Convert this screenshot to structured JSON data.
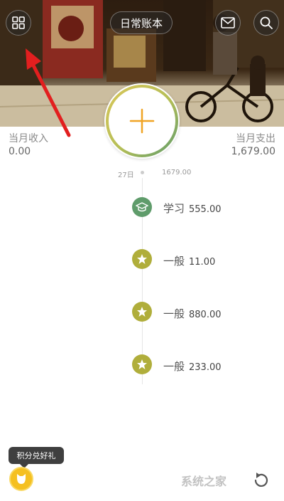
{
  "header": {
    "book_title": "日常账本",
    "menu_icon": "grid-icon",
    "message_icon": "mail-icon",
    "search_icon": "search-icon"
  },
  "summary": {
    "income_label": "当月收入",
    "income_value": "0.00",
    "expense_label": "当月支出",
    "expense_value": "1,679.00"
  },
  "day": {
    "date": "27日",
    "total": "1679.00"
  },
  "entries": [
    {
      "category": "学习",
      "amount": "555.00",
      "icon": "graduation-cap-icon",
      "color": "#5f9c6b"
    },
    {
      "category": "一般",
      "amount": "11.00",
      "icon": "star-icon",
      "color": "#b0ae3b"
    },
    {
      "category": "一般",
      "amount": "880.00",
      "icon": "star-icon",
      "color": "#b0ae3b"
    },
    {
      "category": "一般",
      "amount": "233.00",
      "icon": "star-icon",
      "color": "#b0ae3b"
    }
  ],
  "reward": {
    "tip": "积分兑好礼"
  },
  "watermark": "系统之家",
  "colors": {
    "accent_orange": "#f0a424",
    "ring_green": "#5f9c6b",
    "ring_yellow": "#d8c65a",
    "arrow_red": "#e21f1f"
  }
}
